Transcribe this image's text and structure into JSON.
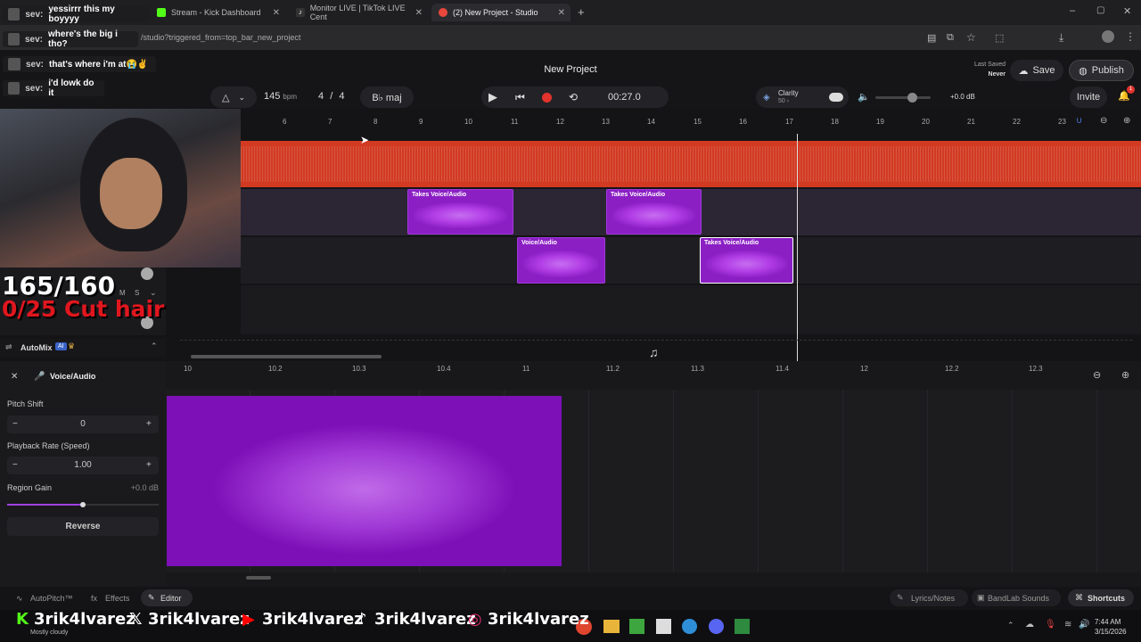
{
  "tabs": [
    {
      "label": "Stream - Kick Dashboard",
      "color": "#53fc18"
    },
    {
      "label": "Monitor LIVE | TikTok LIVE Cent",
      "color": "#ffffff"
    },
    {
      "label": "(2) New Project - Studio",
      "color": "#e8473c"
    }
  ],
  "url": "/studio?triggered_from=top_bar_new_project",
  "chat": [
    {
      "user": "sev:",
      "text": "yessirrr this my boyyyy"
    },
    {
      "user": "sev:",
      "text": "where's the big i tho?"
    },
    {
      "user": "sev:",
      "text": "that's where i'm at😭✌"
    },
    {
      "user": "sev:",
      "text": "i'd lowk do it"
    }
  ],
  "project": {
    "title": "New Project",
    "last_saved_label": "Last Saved",
    "last_saved_value": "Never",
    "save": "Save",
    "publish": "Publish",
    "invite": "Invite",
    "notif_count": "1"
  },
  "transport": {
    "bpm": "145",
    "bpm_unit": "bpm",
    "time_sig_num": "4",
    "time_sig_den": "4",
    "key": "B♭ maj",
    "time": "00:27.0",
    "clarity_label": "Clarity",
    "clarity_value": "50 ›",
    "volume": "+0.0 dB"
  },
  "ruler": [
    "6",
    "7",
    "8",
    "9",
    "10",
    "11",
    "12",
    "13",
    "14",
    "15",
    "16",
    "17",
    "18",
    "19",
    "20",
    "21",
    "22",
    "23"
  ],
  "clips": [
    {
      "header": "Takes  Voice/Audio"
    },
    {
      "header": "Takes  Voice/Audio"
    },
    {
      "header": "Voice/Audio"
    },
    {
      "header": "Takes  Voice/Audio"
    }
  ],
  "overlay": {
    "counter": "165/160",
    "goal": "0/25 Cut hair"
  },
  "automix": {
    "label": "AutoMix",
    "badge": "AI"
  },
  "editor": {
    "track": "Voice/Audio",
    "ruler": [
      "10",
      "10.2",
      "10.3",
      "10.4",
      "11",
      "11.2",
      "11.3",
      "11.4",
      "12",
      "12.2",
      "12.3"
    ],
    "pitch_label": "Pitch Shift",
    "pitch_value": "0",
    "rate_label": "Playback Rate (Speed)",
    "rate_value": "1.00",
    "gain_label": "Region Gain",
    "gain_value": "+0.0 dB",
    "reverse": "Reverse"
  },
  "footer": {
    "autopitch": "AutoPitch™",
    "effects": "Effects",
    "editor": "Editor",
    "lyrics": "Lyrics/Notes",
    "sounds": "BandLab Sounds",
    "shortcuts": "Shortcuts"
  },
  "socials": {
    "kick": "3rik4lvarez",
    "x": "3rik4lvarez",
    "youtube": "3rik4lvarez",
    "tiktok": "3rik4lvarez",
    "instagram": "3rik4lvarez"
  },
  "taskbar": {
    "weather": "Mostly cloudy",
    "time": "7:44 AM",
    "date": "3/15/2026"
  }
}
